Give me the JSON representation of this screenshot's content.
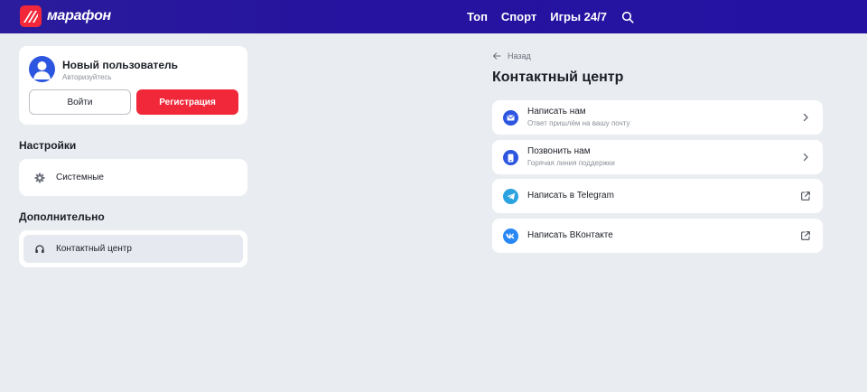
{
  "header": {
    "logo_text": "марафон",
    "nav": [
      "Топ",
      "Спорт",
      "Игры 24/7"
    ]
  },
  "user": {
    "name": "Новый пользователь",
    "subtitle": "Авторизуйтесь",
    "login_label": "Войти",
    "register_label": "Регистрация"
  },
  "settings": {
    "title": "Настройки",
    "items": [
      {
        "label": "Системные",
        "icon": "gear-icon"
      }
    ]
  },
  "extra": {
    "title": "Дополнительно",
    "items": [
      {
        "label": "Контактный центр",
        "icon": "headset-icon",
        "active": true
      }
    ]
  },
  "contact_page": {
    "back_label": "Назад",
    "title": "Контактный центр",
    "items": [
      {
        "title": "Написать нам",
        "subtitle": "Ответ пришлём на вашу почту",
        "icon": "mail-icon",
        "action": "chevron-right-icon"
      },
      {
        "title": "Позвонить нам",
        "subtitle": "Горячая линия поддержки",
        "icon": "phone-icon",
        "action": "chevron-right-icon"
      },
      {
        "title": "Написать в Telegram",
        "subtitle": "",
        "icon": "telegram-icon",
        "action": "external-link-icon"
      },
      {
        "title": "Написать ВКонтакте",
        "subtitle": "",
        "icon": "vk-icon",
        "action": "external-link-icon"
      }
    ]
  },
  "colors": {
    "header_bg": "#2414a6",
    "accent_red": "#f0283a",
    "accent_blue": "#2d56e0",
    "telegram_blue": "#2aa3e0",
    "vk_blue": "#2787f5",
    "page_bg": "#e9ecf0"
  }
}
